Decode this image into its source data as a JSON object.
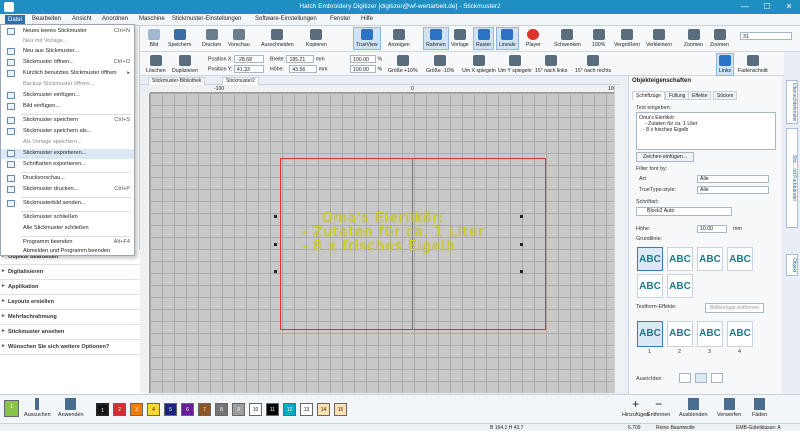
{
  "window": {
    "title": "Hatch Embroidery Digitizer [digitizer@wf-wertarbeit.de] - Stickmuster2",
    "minimize": "—",
    "maximize": "☐",
    "close": "✕"
  },
  "menu": [
    "Datei",
    "Bearbeiten",
    "Ansicht",
    "Anordnen",
    "Maschine",
    "Stickmuster-Einstellungen",
    "Software-Einstellungen",
    "Fenster",
    "Hilfe"
  ],
  "dropdown": [
    {
      "label": "Neues leeres Stickmuster",
      "shortcut": "Ctrl+N"
    },
    {
      "label": "Neu mit Vorlage...",
      "shortcut": "",
      "disabled": true
    },
    {
      "label": "Neu aus Stickmuster...",
      "shortcut": ""
    },
    {
      "label": "Stickmuster öffnen...",
      "shortcut": "Ctrl+O"
    },
    {
      "label": "Kürzlich benutztes Stickmuster öffnen",
      "shortcut": "",
      "submenu": true
    },
    {
      "label": "Backup Stickmuster öffnen...",
      "shortcut": "",
      "disabled": true
    },
    {
      "label": "Stickmuster einfügen...",
      "shortcut": ""
    },
    {
      "label": "Bild einfügen...",
      "shortcut": ""
    },
    {
      "label": "Stickmuster speichern",
      "shortcut": "Ctrl+S"
    },
    {
      "label": "Stickmuster speichern als...",
      "shortcut": ""
    },
    {
      "label": "Als Vorlage speichern...",
      "shortcut": "",
      "disabled": true
    },
    {
      "label": "Stickmuster exportieren...",
      "shortcut": "",
      "highlight": true
    },
    {
      "label": "Schriftarten exportieren...",
      "shortcut": ""
    },
    {
      "label": "Druckvorschau...",
      "shortcut": ""
    },
    {
      "label": "Stickmuster drucken...",
      "shortcut": "Ctrl+P"
    },
    {
      "label": "Stickmusterbild senden...",
      "shortcut": ""
    },
    {
      "label": "Stickmuster schließen",
      "shortcut": ""
    },
    {
      "label": "Alle Stickmuster schließen",
      "shortcut": ""
    },
    {
      "label": "Programm beenden",
      "shortcut": "Alt+F4"
    },
    {
      "label": "Abmelden und Programm beenden",
      "shortcut": ""
    }
  ],
  "toolbar1": [
    "Bild",
    "Speichern",
    "Drucken",
    "Vorschau",
    "Ausschneiden",
    "Kopieren",
    "TrueView",
    "Anzeigen",
    "Rahmen",
    "Vorlage",
    "Raster",
    "Lineale",
    "Player",
    "Schwenken",
    "100%",
    "Vergrößern",
    "Verkleinern",
    "Zoomen",
    "Zoomen"
  ],
  "zoom_select": "31",
  "toolbar2": {
    "buttons": [
      "Löschen",
      "Duplizieren",
      "Größe +10%",
      "Größe -10%",
      "Um X spiegeln",
      "Um Y spiegeln",
      "15° nach links",
      "15° nach rechts",
      "Links",
      "Fadenschnitt"
    ],
    "pos_x_label": "Position X:",
    "pos_x": "-28.68",
    "pos_y_label": "Position Y:",
    "pos_y": "41.33",
    "width_label": "Breite:",
    "width": "185.21",
    "height_label": "Höhe:",
    "height": "43.56",
    "unit": "mm",
    "pct_w": "100.00",
    "pct_h": "100.00",
    "pct": "%"
  },
  "doc_tabs": [
    "Stickmuster-Bibliothek",
    "Stickmuster2"
  ],
  "ruler": {
    "l100": "-100",
    "l0": "0",
    "l100p": "100"
  },
  "embroidery_lines": [
    "Oma's Eierlikör:",
    "- Zutaten für ca. 1 Liter",
    "- 8 x frisches Eigelb"
  ],
  "left_panel": [
    "Objekte bearbeiten",
    "Digitalisieren",
    "Applikation",
    "Layouts erstellen",
    "Mehrfachrahmung",
    "Stickmuster ansehen",
    "Wünschen Sie sich weitere Optionen?"
  ],
  "right_panel": {
    "title": "Objekteigenschaften",
    "tabs": [
      "Schriftzüge",
      "Füllung",
      "Effekte",
      "Sticken"
    ],
    "text_label": "Text eingeben:",
    "text_lines": [
      "Oma's Eierlikör:",
      "- Zutaten für ca. 1 Liter",
      "- 8 x frisches Eigelb"
    ],
    "insert_chars_btn": "Zeichen einfügen...",
    "font_filter": "Filter font by:",
    "art_label": "Art:",
    "art_value": "Alle",
    "truetype_label": "TrueType-style:",
    "truetype_value": "Alle",
    "font_label": "Schriftart:",
    "font_value": "Block2 Auto",
    "height_label": "Höhe:",
    "height_value": "10.00",
    "height_unit": "mm",
    "baselines": "Grundlinie:",
    "effects_label": "Textform-Effekte:",
    "remove_btn": "Bildvorlage entfernen",
    "align_label": "Ausrichten",
    "thumb_label": "ABC",
    "effect_nums": [
      "1",
      "2",
      "3",
      "4"
    ]
  },
  "side_tabs": [
    "Übersichtsfenster",
    "Stic…nd Farbbänder",
    "Objekt"
  ],
  "colors": [
    {
      "n": "1",
      "c": "#8bc34a",
      "dark": false
    },
    {
      "n": "1",
      "c": "#111111",
      "dark": true
    },
    {
      "n": "2",
      "c": "#d32f2f",
      "dark": true
    },
    {
      "n": "3",
      "c": "#f57c00",
      "dark": true
    },
    {
      "n": "4",
      "c": "#fdd835",
      "dark": false
    },
    {
      "n": "5",
      "c": "#1a237e",
      "dark": true
    },
    {
      "n": "6",
      "c": "#6a1b9a",
      "dark": true
    },
    {
      "n": "7",
      "c": "#8d5524",
      "dark": true
    },
    {
      "n": "8",
      "c": "#757575",
      "dark": true
    },
    {
      "n": "9",
      "c": "#9e9e9e",
      "dark": true
    },
    {
      "n": "10",
      "c": "#ffffff",
      "dark": false
    },
    {
      "n": "11",
      "c": "#000000",
      "dark": true
    },
    {
      "n": "12",
      "c": "#00acc1",
      "dark": true
    },
    {
      "n": "13",
      "c": "#ffffff",
      "dark": false
    },
    {
      "n": "14",
      "c": "#ffe0b2",
      "dark": false
    },
    {
      "n": "15",
      "c": "#ffe0b2",
      "dark": false
    }
  ],
  "bottom_left": [
    "Aussuchen",
    "Anwenden"
  ],
  "bottom_right": [
    "Hinzufügen",
    "Entfernen",
    "Ausblenden",
    "Verwerfen",
    "Fäden"
  ],
  "status": {
    "coords": "B 164.1 H 43.7",
    "stitches": "6.709",
    "thread": "Reine Baumwolle",
    "fabric": "EMB-Gütetklasse: A"
  }
}
